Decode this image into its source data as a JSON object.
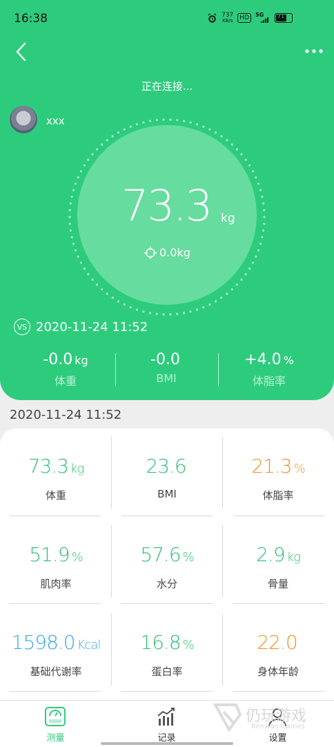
{
  "status": {
    "time": "16:38",
    "net_speed": "737",
    "net_unit": "KB/s",
    "hd": "HD",
    "net_type": "5G",
    "battery": "71"
  },
  "header": {
    "connecting": "正在连接...",
    "username": "xxx",
    "weight": "73.3",
    "weight_unit": "kg",
    "diff": "0.0kg",
    "vs_label": "VS",
    "compare_date": "2020-11-24 11:52",
    "compare": [
      {
        "value": "-0.0",
        "unit": "kg",
        "label": "体重"
      },
      {
        "value": "-0.0",
        "unit": "",
        "label": "BMI"
      },
      {
        "value": "+4.0",
        "unit": "%",
        "label": "体脂率"
      }
    ]
  },
  "record_date": "2020-11-24 11:52",
  "metrics": [
    {
      "value": "73.3",
      "unit": "kg",
      "label": "体重",
      "color": "#2fbf74"
    },
    {
      "value": "23.6",
      "unit": "",
      "label": "BMI",
      "color": "#2fbf74"
    },
    {
      "value": "21.3",
      "unit": "%",
      "label": "体脂率",
      "color": "#f0922e"
    },
    {
      "value": "51.9",
      "unit": "%",
      "label": "肌肉率",
      "color": "#2fbf74"
    },
    {
      "value": "57.6",
      "unit": "%",
      "label": "水分",
      "color": "#2fbf74"
    },
    {
      "value": "2.9",
      "unit": "kg",
      "label": "骨量",
      "color": "#2fbf74"
    },
    {
      "value": "1598.0",
      "unit": "Kcal",
      "label": "基础代谢率",
      "color": "#3aa9e3"
    },
    {
      "value": "16.8",
      "unit": "%",
      "label": "蛋白率",
      "color": "#2fbf74"
    },
    {
      "value": "22.0",
      "unit": "",
      "label": "身体年龄",
      "color": "#f0922e"
    }
  ],
  "tabs": [
    {
      "label": "测量",
      "icon": "scale-icon",
      "active": true
    },
    {
      "label": "记录",
      "icon": "chart-icon",
      "active": false
    },
    {
      "label": "设置",
      "icon": "user-icon",
      "active": false
    }
  ],
  "watermark": {
    "text": "仍玩游戏",
    "sub": "Renwan Games"
  },
  "colors": {
    "primary": "#2dcc7d",
    "circle": "#66dc9f",
    "green": "#2fbf74",
    "orange": "#f0922e",
    "blue": "#3aa9e3"
  }
}
